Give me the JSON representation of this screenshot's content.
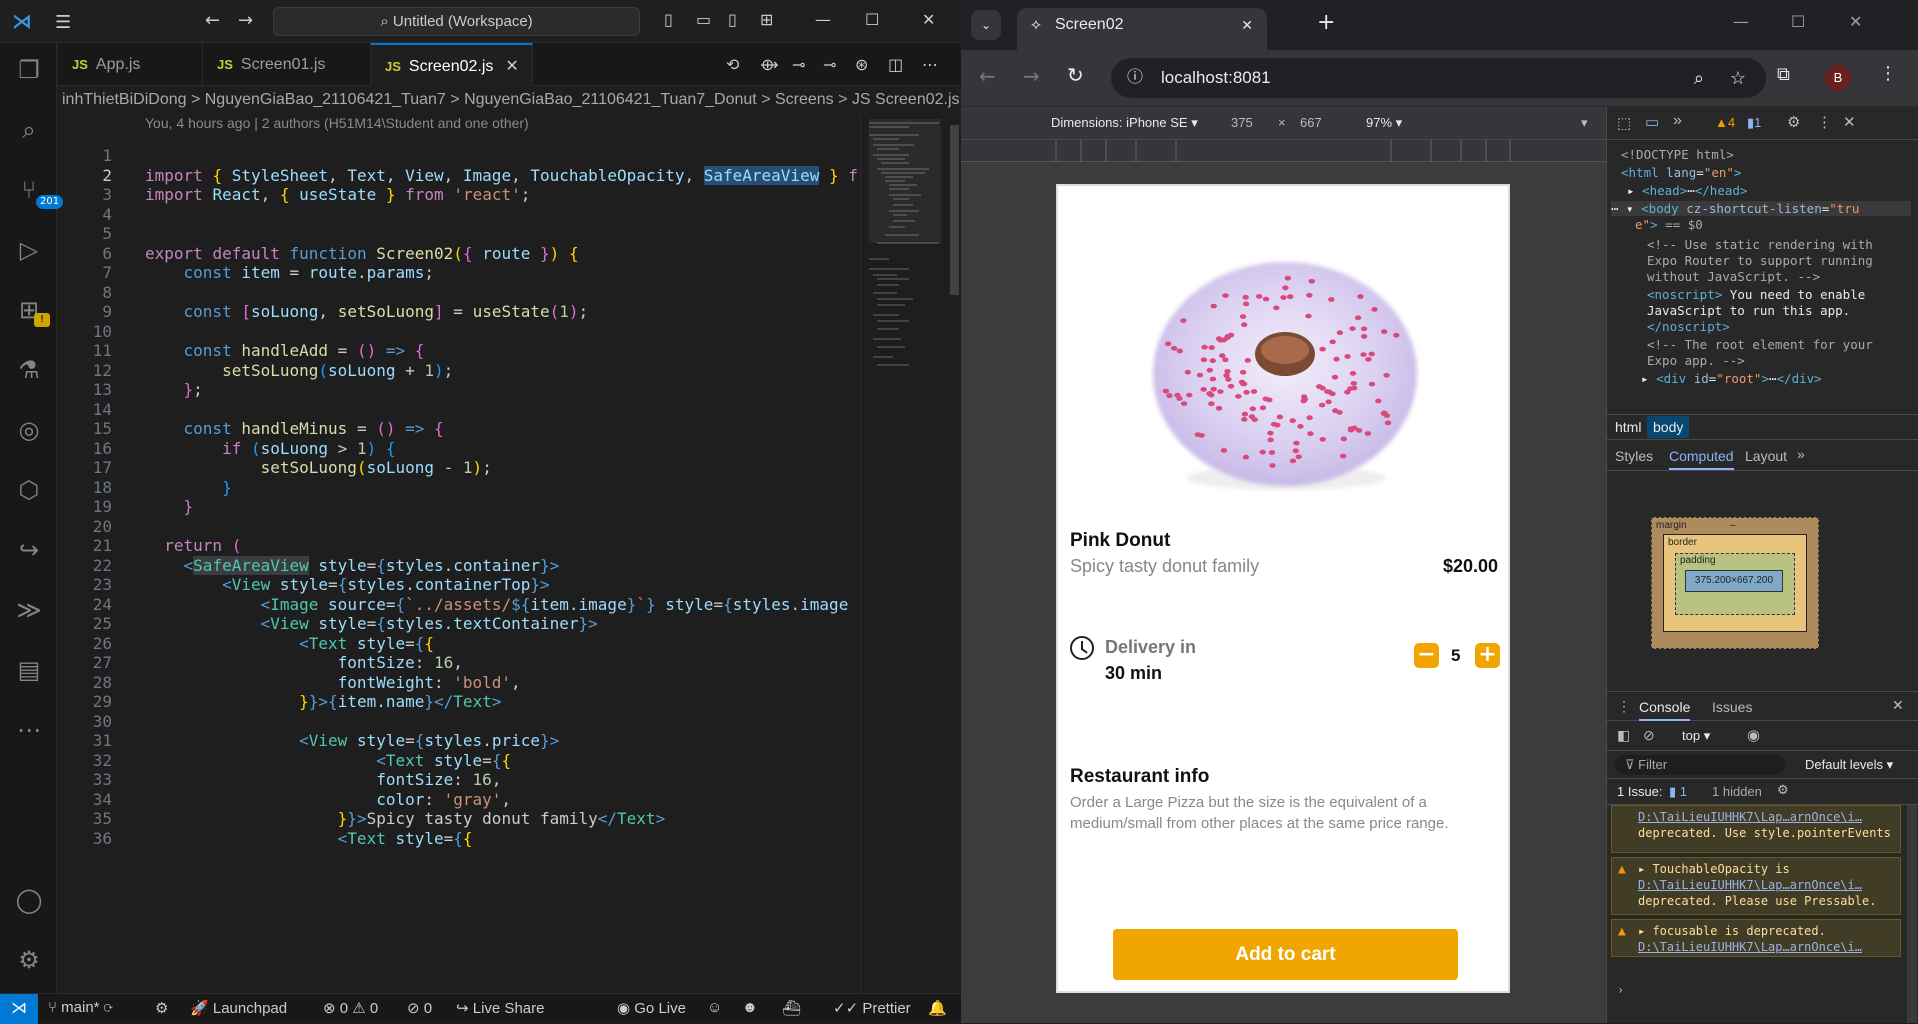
{
  "vscode": {
    "title": "Untitled (Workspace)",
    "tabs": [
      {
        "icon": "JS",
        "label": "App.js"
      },
      {
        "icon": "JS",
        "label": "Screen01.js"
      },
      {
        "icon": "JS",
        "label": "Screen02.js"
      }
    ],
    "breadcrumb": "inhThietBiDiDong > NguyenGiaBao_21106421_Tuan7 > NguyenGiaBao_21106421_Tuan7_Donut > Screens > JS Screen02.js",
    "blame": "You, 4 hours ago | 2 authors (H51M14\\Student and one other)",
    "scm_badge": "201",
    "line_numbers": [
      "1",
      "2",
      "3",
      "4",
      "5",
      "6",
      "7",
      "8",
      "9",
      "10",
      "11",
      "12",
      "13",
      "14",
      "15",
      "16",
      "17",
      "18",
      "19",
      "20",
      "21",
      "22",
      "23",
      "24",
      "25",
      "26",
      "27",
      "28",
      "29",
      "30",
      "31",
      "32",
      "33",
      "34",
      "35",
      "36"
    ],
    "status": {
      "branch": "main*",
      "launchpad": "Launchpad",
      "problems": "0",
      "warnings": "0",
      "ports": "0",
      "liveshare": "Live Share",
      "golive": "Go Live",
      "prettier": "Prettier"
    }
  },
  "chrome": {
    "tab_title": "Screen02",
    "url": "localhost:8081",
    "profile": "B",
    "device": "Dimensions: iPhone SE",
    "width": "375",
    "height": "667",
    "zoom": "97%",
    "app": {
      "name": "Pink Donut",
      "subtitle": "Spicy tasty donut family",
      "price": "$20.00",
      "delivery_label": "Delivery in",
      "delivery_time": "30 min",
      "quantity": "5",
      "info_title": "Restaurant info",
      "info_text": "Order a Large Pizza but the size is the equivalent of a medium/small from other places at the same price range.",
      "cart_button": "Add to cart"
    }
  },
  "devtools": {
    "warnings_count": "4",
    "messages_count": "1",
    "crumbs": [
      "html",
      "body"
    ],
    "style_tabs": [
      "Styles",
      "Computed",
      "Layout"
    ],
    "box": {
      "margin": "margin",
      "border": "border",
      "padding": "padding",
      "content": "375.200×667.200",
      "dash": "–"
    },
    "console_tabs": [
      "Console",
      "Issues"
    ],
    "context": "top",
    "filter_placeholder": "Filter",
    "levels": "Default levels",
    "issues": "1 Issue:",
    "issues_count": "1",
    "hidden": "1 hidden",
    "messages": [
      {
        "link": "D:\\TaiLieuIUHHK7\\Lap…arnOnce\\i…",
        "text": "deprecated. Use style.pointerEvents"
      },
      {
        "head": "TouchableOpacity is",
        "link": "D:\\TaiLieuIUHHK7\\Lap…arnOnce\\i…",
        "text": "deprecated. Please use Pressable."
      },
      {
        "head": "focusable is deprecated.",
        "link": "D:\\TaiLieuIUHHK7\\Lap…arnOnce\\i…"
      }
    ]
  }
}
